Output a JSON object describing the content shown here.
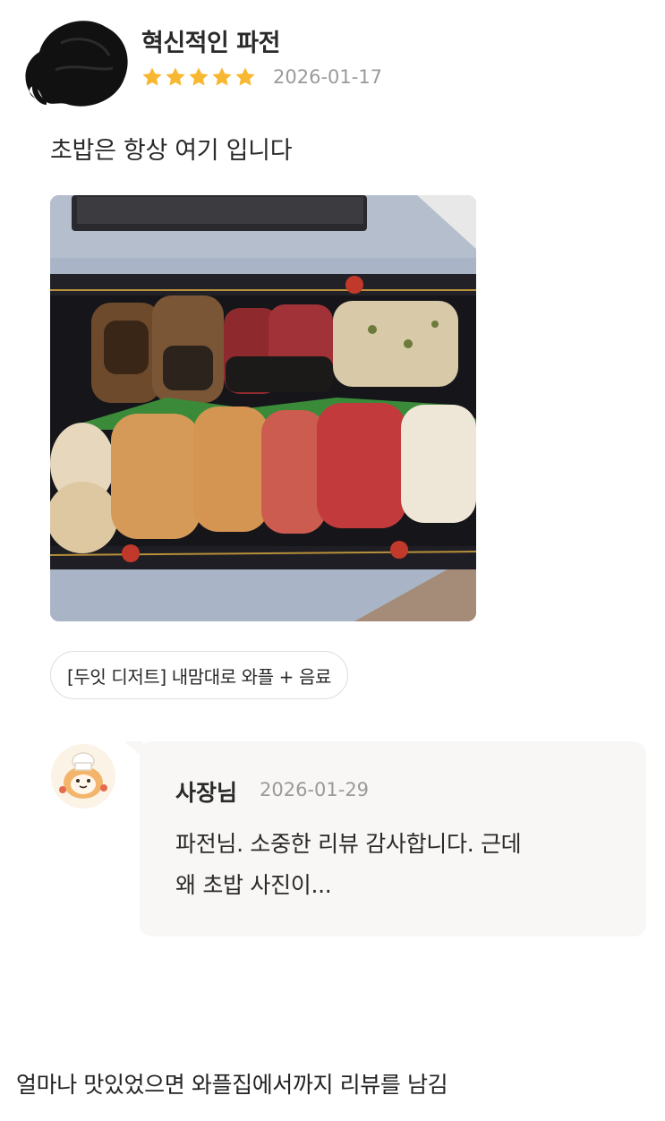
{
  "review": {
    "reviewer_name": "혁신적인 파전",
    "rating": 5,
    "date": "2026-01-17",
    "text": "초밥은 항상 여기 입니다",
    "photo": "sushi-platter-photo",
    "menu_chip": "[두잇 디저트] 내맘대로 와플 + 음료"
  },
  "reply": {
    "owner_name": "사장님",
    "date": "2026-01-29",
    "text_line1": "파전님. 소중한 리뷰 감사합니다. 근데",
    "text_line2": "왜 초밥 사진이...",
    "avatar": "chef-mascot-icon"
  },
  "caption": "얼마나 맛있었으면 와플집에서까지 리뷰를 남김",
  "colors": {
    "star": "#f7b731",
    "muted": "#9a9a9a",
    "reply_bg": "#f8f7f5",
    "text": "#2a2a2a"
  }
}
